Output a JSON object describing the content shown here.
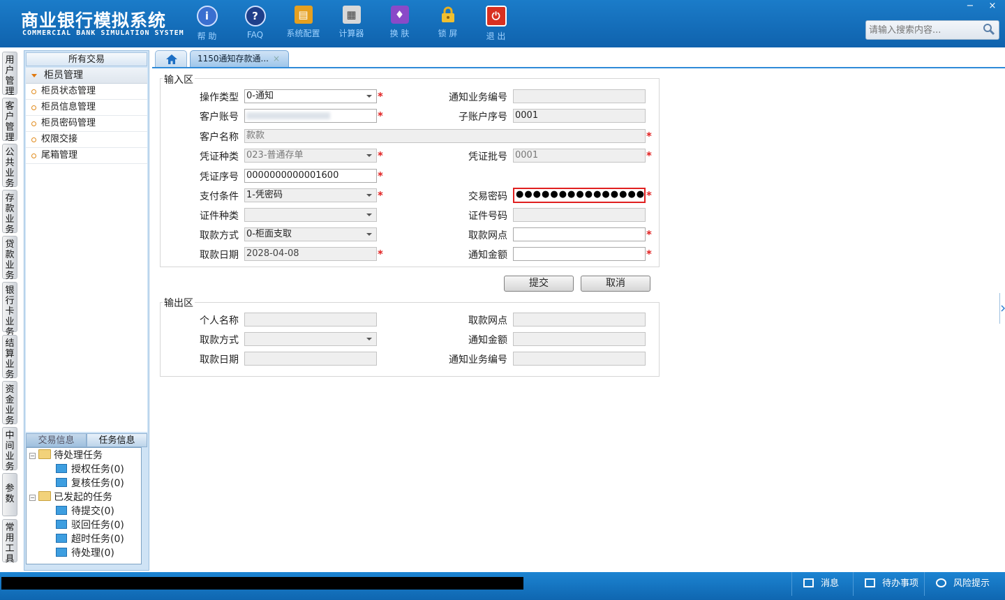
{
  "header": {
    "title_cn": "商业银行模拟系统",
    "title_en": "COMMERCIAL BANK SIMULATION SYSTEM",
    "toolbar": [
      {
        "label": "帮 助",
        "icon": "help-icon",
        "glyph": "i",
        "color": "#3a6fd0"
      },
      {
        "label": "FAQ",
        "icon": "faq-icon",
        "glyph": "?",
        "color": "#1f3f8a"
      },
      {
        "label": "系统配置",
        "icon": "toolbox-icon",
        "glyph": "▤",
        "color": "#e5a020"
      },
      {
        "label": "计算器",
        "icon": "calculator-icon",
        "glyph": "▦",
        "color": "#6a6a6a"
      },
      {
        "label": "换 肤",
        "icon": "skin-icon",
        "glyph": "♦",
        "color": "#8a4ac8"
      },
      {
        "label": "锁 屏",
        "icon": "lock-icon",
        "glyph": "🔒",
        "color": "#e0a010"
      },
      {
        "label": "退 出",
        "icon": "power-icon",
        "glyph": "⏻",
        "color": "#d83020"
      }
    ],
    "window_controls": {
      "minimize": "−",
      "close": "×"
    },
    "search": {
      "placeholder": "请输入搜索内容..."
    }
  },
  "vtabs": [
    "用户管理",
    "客户管理",
    "公共业务",
    "存款业务",
    "贷款业务",
    "银行卡业务",
    "结算业务",
    "资金业务",
    "中间业务",
    "参数",
    "常用工具"
  ],
  "sidebar": {
    "header": "所有交易",
    "group": "柜员管理",
    "items": [
      "柜员状态管理",
      "柜员信息管理",
      "柜员密码管理",
      "权限交接",
      "尾箱管理"
    ],
    "task_tabs": [
      "交易信息",
      "任务信息"
    ],
    "tree": {
      "pending": "待处理任务",
      "pending_items": [
        "授权任务(0)",
        "复核任务(0)"
      ],
      "initiated": "已发起的任务",
      "initiated_items": [
        "待提交(0)",
        "驳回任务(0)",
        "超时任务(0)",
        "待处理(0)"
      ]
    }
  },
  "tabs": {
    "doc_tab": "1150通知存款通...",
    "close": "×"
  },
  "input_area": {
    "legend": "输入区",
    "op_type": {
      "label": "操作类型",
      "value": "0-通知"
    },
    "notice_no": {
      "label": "通知业务编号",
      "value": ""
    },
    "account": {
      "label": "客户账号",
      "value": ""
    },
    "sub_account": {
      "label": "子账户序号",
      "value": "0001"
    },
    "customer_name": {
      "label": "客户名称",
      "value": "款款"
    },
    "voucher_type": {
      "label": "凭证种类",
      "value": "023-普通存单"
    },
    "voucher_batch": {
      "label": "凭证批号",
      "value": "0001"
    },
    "voucher_no": {
      "label": "凭证序号",
      "value": "0000000000001600"
    },
    "pay_condition": {
      "label": "支付条件",
      "value": "1-凭密码"
    },
    "trade_password": {
      "label": "交易密码",
      "value": "●●●●●●●●●●●●●●●"
    },
    "id_type": {
      "label": "证件种类",
      "value": ""
    },
    "id_no": {
      "label": "证件号码",
      "value": ""
    },
    "withdraw_method": {
      "label": "取款方式",
      "value": "0-柜面支取"
    },
    "withdraw_branch": {
      "label": "取款网点",
      "value": ""
    },
    "withdraw_date": {
      "label": "取款日期",
      "value": "2028-04-08"
    },
    "notice_amount": {
      "label": "通知金额",
      "value": ""
    },
    "required_mark": "*"
  },
  "buttons": {
    "submit": "提交",
    "cancel": "取消"
  },
  "output_area": {
    "legend": "输出区",
    "personal_name": "个人名称",
    "withdraw_branch": "取款网点",
    "withdraw_method": "取款方式",
    "notice_amount": "通知金额",
    "withdraw_date": "取款日期",
    "notice_no": "通知业务编号"
  },
  "statusbar": {
    "message": "消息",
    "todo": "待办事项",
    "risk": "风险提示"
  }
}
